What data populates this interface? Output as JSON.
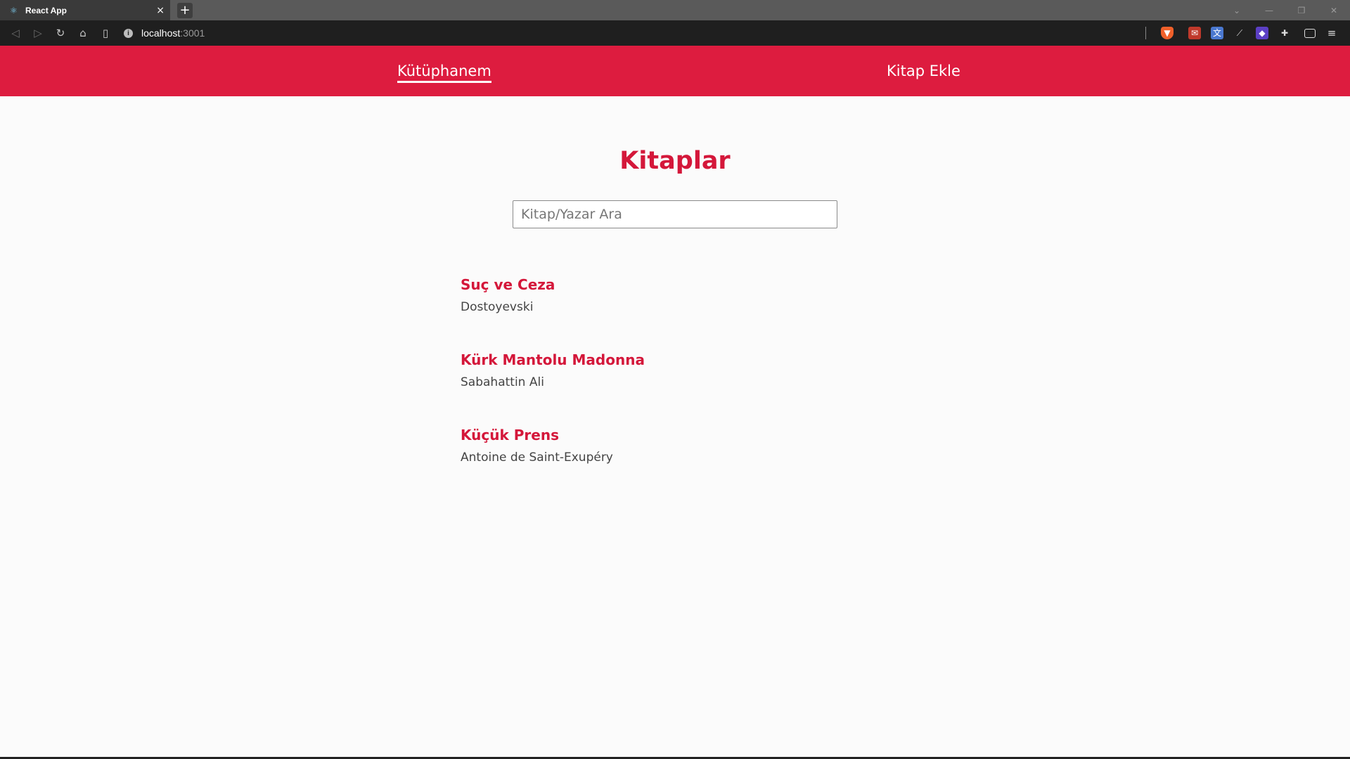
{
  "browser": {
    "tab_title": "React App",
    "tab_close": "×",
    "new_tab": "+",
    "url_host": "localhost",
    "url_port": ":3001",
    "info_glyph": "i",
    "icons": [
      "back-icon",
      "forward-icon",
      "reload-icon",
      "home-icon",
      "bookmark-icon",
      "site-info-icon",
      "brave-shield-icon",
      "extension-icon",
      "translate-icon",
      "extension-icon",
      "extension-icon",
      "puzzle-icon",
      "wallet-icon",
      "menu-icon"
    ],
    "window_controls": [
      "chevron-down-icon",
      "minimize-icon",
      "restore-icon",
      "close-icon"
    ]
  },
  "nav": {
    "home_label": "Kütüphanem",
    "add_label": "Kitap Ekle"
  },
  "main": {
    "title": "Kitaplar",
    "search_placeholder": "Kitap/Yazar Ara"
  },
  "books": [
    {
      "title": "Suç ve Ceza",
      "author": "Dostoyevski"
    },
    {
      "title": "Kürk Mantolu Madonna",
      "author": "Sabahattin Ali"
    },
    {
      "title": "Küçük Prens",
      "author": "Antoine de Saint-Exupéry"
    }
  ],
  "colors": {
    "accent": "#dd1c3f",
    "title_red": "#d4173a",
    "background": "#fbfbfb"
  }
}
